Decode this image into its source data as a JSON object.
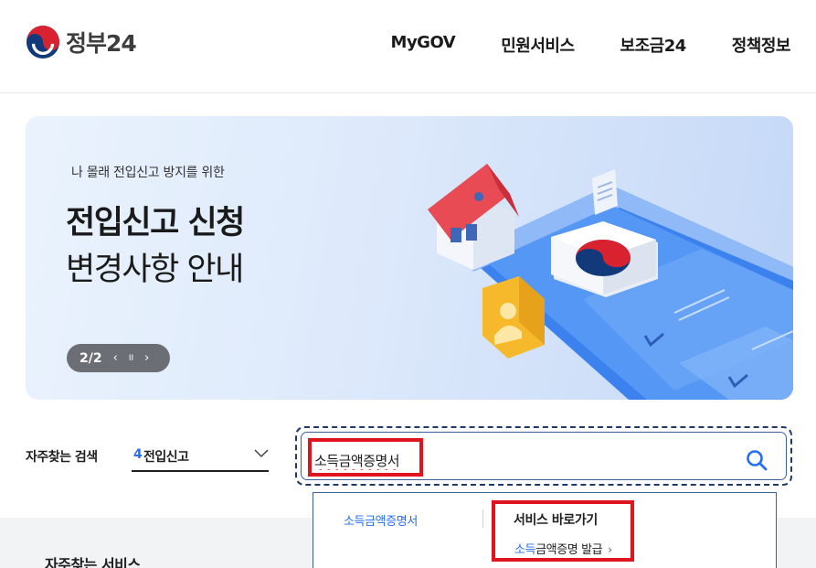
{
  "header": {
    "logo_text": "정부24",
    "nav": [
      "MyGOV",
      "민원서비스",
      "보조금24",
      "정책정보"
    ]
  },
  "banner": {
    "subtitle": "나 몰래 전입신고 방지를 위한",
    "title_line1": "전입신고 신청",
    "title_line2": "변경사항 안내",
    "pager": {
      "count": "2/2",
      "prev": "‹",
      "pause": "II",
      "next": "›"
    }
  },
  "search": {
    "faq_label": "자주찾는 검색",
    "faq_rank": "4",
    "faq_value": "전입신고",
    "input_value": "소득금액증명서",
    "icon": "search-icon"
  },
  "dropdown": {
    "suggestion": "소득금액증명서",
    "shortcut_heading": "서비스 바로가기",
    "shortcut_link_highlight": "소득",
    "shortcut_link_rest": "금액증명 발급",
    "shortcut_arrow": "›"
  },
  "section": {
    "faq_service_title": "자주찾는 서비스"
  },
  "colors": {
    "accent": "#256ef4",
    "highlight_box": "#e0141e",
    "search_border": "#1f3a68"
  }
}
